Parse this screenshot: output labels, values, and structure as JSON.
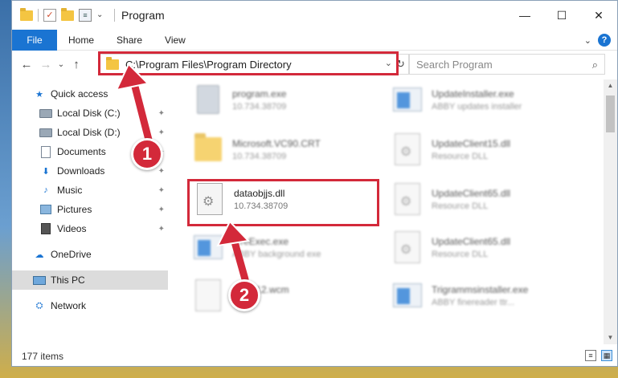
{
  "window": {
    "title": "Program",
    "controls": {
      "minimize": "—",
      "maximize": "☐",
      "close": "✕"
    }
  },
  "ribbon": {
    "file": "File",
    "tabs": [
      "Home",
      "Share",
      "View"
    ],
    "expand": "⌄",
    "help": "?"
  },
  "nav": {
    "back": "←",
    "forward": "→",
    "recent": "⌄",
    "up": "↑"
  },
  "address": {
    "path": "C:\\Program Files\\Program Directory",
    "chevron": "⌄",
    "refresh": "↻"
  },
  "search": {
    "placeholder": "Search Program",
    "icon": "⌕"
  },
  "sidebar": {
    "items": [
      {
        "label": "Quick access",
        "icon": "star-icon",
        "pinned": false
      },
      {
        "label": "Local Disk (C:)",
        "icon": "disk-icon",
        "pinned": true
      },
      {
        "label": "Local Disk (D:)",
        "icon": "disk-icon",
        "pinned": true
      },
      {
        "label": "Documents",
        "icon": "document-icon",
        "pinned": true
      },
      {
        "label": "Downloads",
        "icon": "download-icon",
        "pinned": true
      },
      {
        "label": "Music",
        "icon": "music-icon",
        "pinned": true
      },
      {
        "label": "Pictures",
        "icon": "picture-icon",
        "pinned": true
      },
      {
        "label": "Videos",
        "icon": "video-icon",
        "pinned": true
      },
      {
        "label": "OneDrive",
        "icon": "cloud-icon",
        "pinned": false
      },
      {
        "label": "This PC",
        "icon": "computer-icon",
        "pinned": false,
        "selected": true
      },
      {
        "label": "Network",
        "icon": "network-icon",
        "pinned": false
      }
    ],
    "pin_glyph": "📌"
  },
  "files": {
    "left": [
      {
        "name": "program.exe",
        "sub": "10.734.38709",
        "type": "exe",
        "blurred": true
      },
      {
        "name": "Microsoft.VC90.CRT",
        "sub": "10.734.38709",
        "type": "folder",
        "blurred": true
      },
      {
        "name": "dataobjjs.dll",
        "sub": "10.734.38709",
        "type": "dll",
        "blurred": false
      },
      {
        "name": "...reExec.exe",
        "sub": "ABBY background exe",
        "type": "app",
        "blurred": true
      },
      {
        "name": "...WP12.wcm",
        "sub": "...le",
        "type": "generic",
        "blurred": true
      }
    ],
    "right": [
      {
        "name": "UpdateInstaller.exe",
        "sub": "ABBY updates installer",
        "type": "app",
        "blurred": true
      },
      {
        "name": "UpdateClient15.dll",
        "sub": "Resource DLL",
        "type": "dll",
        "blurred": true
      },
      {
        "name": "UpdateClient65.dll",
        "sub": "Resource DLL",
        "type": "dll",
        "blurred": true
      },
      {
        "name": "UpdateClient65.dll",
        "sub": "Resource DLL",
        "type": "dll",
        "blurred": true
      },
      {
        "name": "Trigrammsinstaller.exe",
        "sub": "ABBY finereader ttr...",
        "type": "app",
        "blurred": true
      }
    ]
  },
  "status": {
    "items_count": "177 items"
  },
  "annotations": {
    "step1": "1",
    "step2": "2",
    "accent": "#d3293a"
  }
}
